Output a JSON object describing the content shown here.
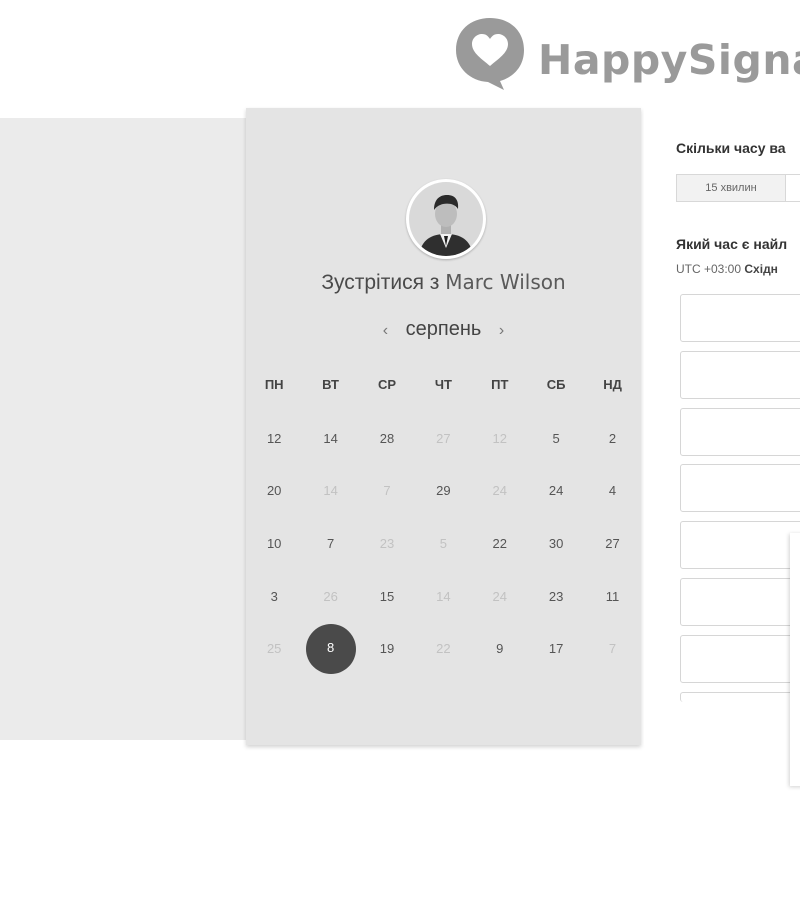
{
  "brand": {
    "logo_text": "HappySigna"
  },
  "calendar": {
    "meet_prefix": "Зустрітися з ",
    "host_name": "Marc Wilson",
    "month": "серпень",
    "prev_arrow": "‹",
    "next_arrow": "›",
    "weekdays": [
      "ПН",
      "ВТ",
      "СР",
      "ЧТ",
      "ПТ",
      "СБ",
      "НД"
    ],
    "rows": [
      [
        {
          "d": "12",
          "s": "active"
        },
        {
          "d": "14",
          "s": "active"
        },
        {
          "d": "28",
          "s": "active"
        },
        {
          "d": "27",
          "s": "dim"
        },
        {
          "d": "12",
          "s": "dim"
        },
        {
          "d": "5",
          "s": "active"
        },
        {
          "d": "2",
          "s": "active"
        }
      ],
      [
        {
          "d": "20",
          "s": "active"
        },
        {
          "d": "14",
          "s": "dim"
        },
        {
          "d": "7",
          "s": "dim"
        },
        {
          "d": "29",
          "s": "active"
        },
        {
          "d": "24",
          "s": "dim"
        },
        {
          "d": "24",
          "s": "active"
        },
        {
          "d": "4",
          "s": "active"
        }
      ],
      [
        {
          "d": "10",
          "s": "active"
        },
        {
          "d": "7",
          "s": "active"
        },
        {
          "d": "23",
          "s": "dim"
        },
        {
          "d": "5",
          "s": "dim"
        },
        {
          "d": "22",
          "s": "active"
        },
        {
          "d": "30",
          "s": "active"
        },
        {
          "d": "27",
          "s": "active"
        }
      ],
      [
        {
          "d": "3",
          "s": "active"
        },
        {
          "d": "26",
          "s": "dim"
        },
        {
          "d": "15",
          "s": "active"
        },
        {
          "d": "14",
          "s": "dim"
        },
        {
          "d": "24",
          "s": "dim"
        },
        {
          "d": "23",
          "s": "active"
        },
        {
          "d": "11",
          "s": "active"
        }
      ],
      [
        {
          "d": "25",
          "s": "dim"
        },
        {
          "d": "8",
          "s": "selected"
        },
        {
          "d": "19",
          "s": "active"
        },
        {
          "d": "22",
          "s": "dim"
        },
        {
          "d": "9",
          "s": "active"
        },
        {
          "d": "17",
          "s": "active"
        },
        {
          "d": "7",
          "s": "dim"
        }
      ]
    ]
  },
  "booking": {
    "duration_question": "Скільки часу ва",
    "duration_options": [
      "15 хвилин",
      ""
    ],
    "time_question": "Який час є найл",
    "timezone_offset": "UTC +03:00",
    "timezone_name": "Східн",
    "slot_count": 7
  }
}
